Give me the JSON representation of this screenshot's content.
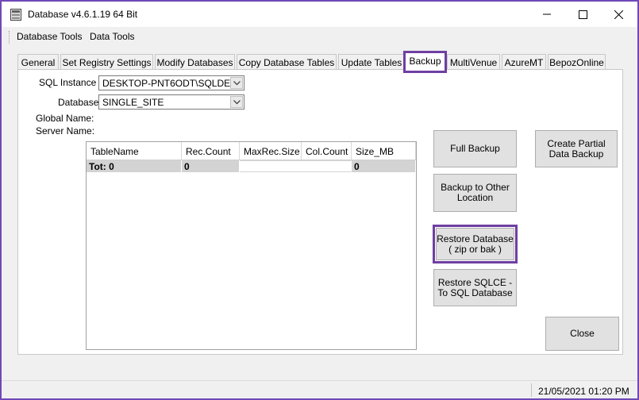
{
  "window": {
    "title": "Database v4.6.1.19 64 Bit",
    "accent_color": "#6f3fa2"
  },
  "menu": {
    "items": [
      "Database Tools",
      "Data Tools"
    ]
  },
  "tabs": [
    {
      "label": "General"
    },
    {
      "label": "Set Registry Settings"
    },
    {
      "label": "Modify Databases"
    },
    {
      "label": "Copy Database Tables"
    },
    {
      "label": "Update Tables"
    },
    {
      "label": "Backup",
      "active": true
    },
    {
      "label": "MultiVenue"
    },
    {
      "label": "AzureMT"
    },
    {
      "label": "BepozOnline"
    }
  ],
  "form": {
    "sql_instance_label": "SQL Instance :",
    "sql_instance_value": "DESKTOP-PNT6ODT\\SQLDE",
    "database_label": "Database:",
    "database_value": "SINGLE_SITE",
    "global_name_label": "Global Name:",
    "server_name_label": "Server Name:"
  },
  "grid": {
    "columns": [
      "TableName",
      "Rec.Count",
      "MaxRec.Size",
      "Col.Count",
      "Size_MB"
    ],
    "total_row": [
      "Tot: 0",
      "0",
      "",
      "",
      "0"
    ]
  },
  "buttons": {
    "full_backup": "Full Backup",
    "create_partial": "Create Partial\nData Backup",
    "backup_other": "Backup to Other\nLocation",
    "restore_database": "Restore Database\n( zip or bak )",
    "restore_sqlce": "Restore SQLCE -\nTo SQL Database",
    "close": "Close"
  },
  "status": {
    "datetime": "21/05/2021 01:20 PM"
  }
}
